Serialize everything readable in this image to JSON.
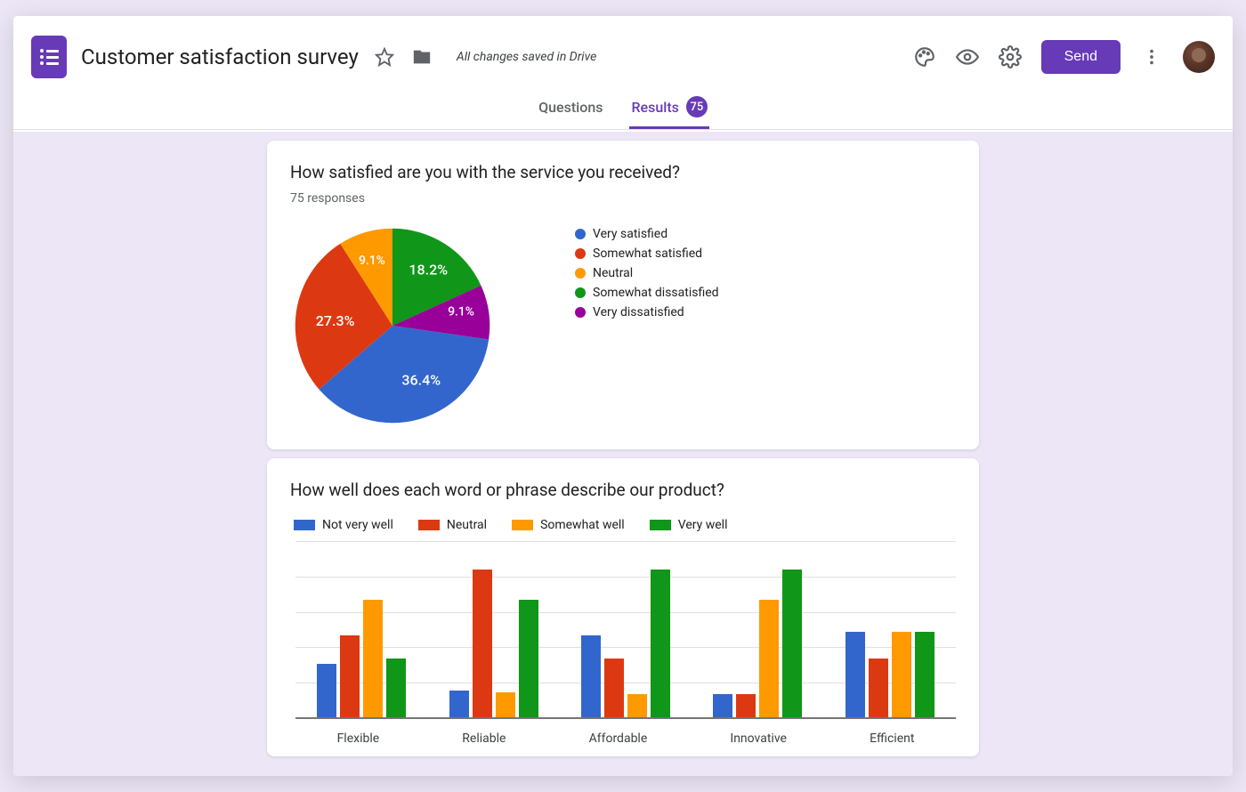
{
  "header": {
    "title": "Customer satisfaction survey",
    "saved_text": "All changes saved in Drive",
    "send_label": "Send"
  },
  "tabs": {
    "questions_label": "Questions",
    "results_label": "Results",
    "results_count": "75"
  },
  "colors": {
    "accent": "#673ab7",
    "blue": "#3366cc",
    "red": "#dc3912",
    "orange": "#ff9900",
    "green": "#109618",
    "purple": "#990099"
  },
  "card1": {
    "title": "How satisfied are you with the service you received?",
    "responses": "75 responses",
    "slice_labels": {
      "very_satisfied": "36.4%",
      "somewhat_satisfied": "27.3%",
      "neutral": "9.1%",
      "somewhat_dissatisfied": "18.2%",
      "very_dissatisfied": "9.1%"
    },
    "legend": {
      "very_satisfied": "Very satisfied",
      "somewhat_satisfied": "Somewhat satisfied",
      "neutral": "Neutral",
      "somewhat_dissatisfied": "Somewhat dissatisfied",
      "very_dissatisfied": "Very dissatisfied"
    }
  },
  "card2": {
    "title": "How well does each word or phrase describe our product?",
    "legend": {
      "not_very_well": "Not very well",
      "neutral": "Neutral",
      "somewhat_well": "Somewhat well",
      "very_well": "Very well"
    },
    "categories": {
      "flexible": "Flexible",
      "reliable": "Reliable",
      "affordable": "Affordable",
      "innovative": "Innovative",
      "efficient": "Efficient"
    }
  },
  "chart_data": [
    {
      "type": "pie",
      "title": "How satisfied are you with the service you received?",
      "responses": 75,
      "series": [
        {
          "name": "Very satisfied",
          "value": 36.4,
          "color": "#3366cc"
        },
        {
          "name": "Somewhat satisfied",
          "value": 27.3,
          "color": "#dc3912"
        },
        {
          "name": "Neutral",
          "value": 9.1,
          "color": "#ff9900"
        },
        {
          "name": "Somewhat dissatisfied",
          "value": 18.2,
          "color": "#109618"
        },
        {
          "name": "Very dissatisfied",
          "value": 9.1,
          "color": "#990099"
        }
      ]
    },
    {
      "type": "bar",
      "title": "How well does each word or phrase describe our product?",
      "categories": [
        "Flexible",
        "Reliable",
        "Affordable",
        "Innovative",
        "Efficient"
      ],
      "series": [
        {
          "name": "Not very well",
          "color": "#3366cc",
          "values": [
            31,
            16,
            47,
            14,
            49
          ]
        },
        {
          "name": "Neutral",
          "color": "#dc3912",
          "values": [
            47,
            84,
            34,
            14,
            34
          ]
        },
        {
          "name": "Somewhat well",
          "color": "#ff9900",
          "values": [
            67,
            15,
            14,
            67,
            49
          ]
        },
        {
          "name": "Very well",
          "color": "#109618",
          "values": [
            34,
            67,
            84,
            84,
            49
          ]
        }
      ],
      "ylim": [
        0,
        100
      ]
    }
  ]
}
